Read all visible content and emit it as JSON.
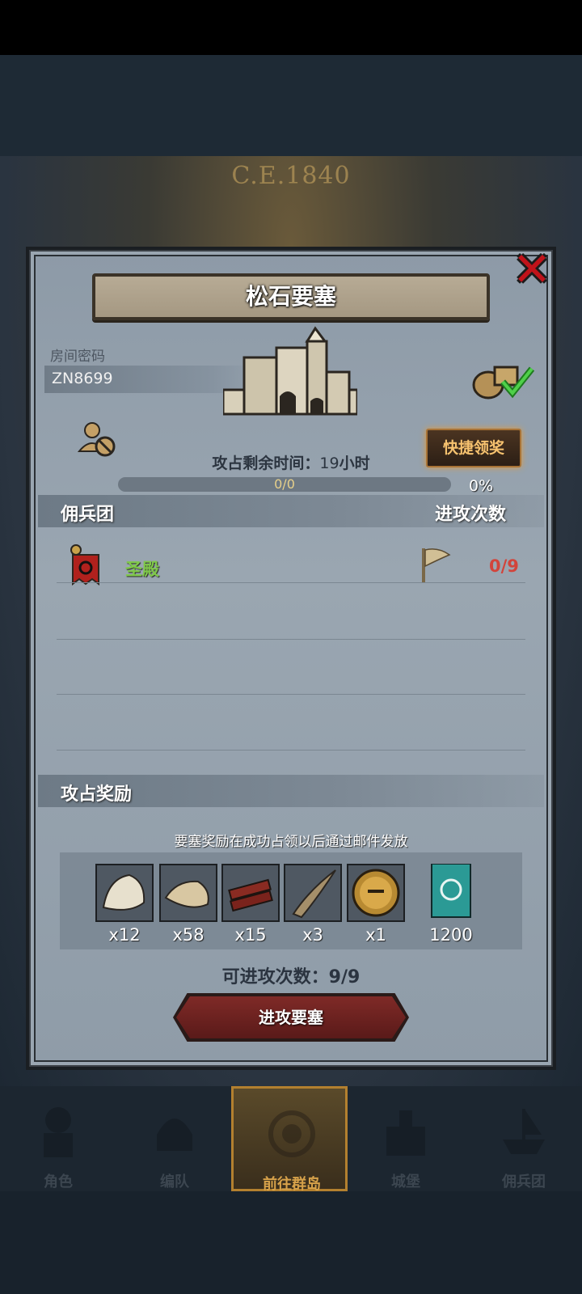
{
  "background": {
    "era_label": "C.E.1840"
  },
  "modal": {
    "title": "松石要塞",
    "room_label": "房间密码",
    "room_code": "ZN8699",
    "quick_claim_label": "快捷领奖",
    "time_label": "攻占剩余时间：",
    "time_value": "19",
    "time_unit": "小时",
    "progress_text": "0/0",
    "progress_fraction": 0,
    "progress_percent": "0%",
    "section_mercenary": "佣兵团",
    "section_attack_count": "进攻次数",
    "mercenary": {
      "name": "圣殿",
      "count": "0/9"
    },
    "section_reward": "攻占奖励",
    "reward_note": "要塞奖励在成功占领以后通过邮件发放",
    "rewards": [
      {
        "icon": "fur-icon",
        "qty": "x12"
      },
      {
        "icon": "leather-icon",
        "qty": "x58"
      },
      {
        "icon": "wood-planks-icon",
        "qty": "x15"
      },
      {
        "icon": "horn-icon",
        "qty": "x3"
      },
      {
        "icon": "knight-helmet-coin-icon",
        "qty": "x1"
      },
      {
        "icon": "guild-banner-icon",
        "qty": "1200"
      }
    ],
    "attempts_label": "可进攻次数：9/9",
    "attack_button": "进攻要塞"
  },
  "nav": {
    "items": [
      {
        "label": "角色",
        "icon": "knight-icon"
      },
      {
        "label": "编队",
        "icon": "helmet-icon"
      },
      {
        "label": "前往群岛",
        "icon": "compass-icon",
        "active": true
      },
      {
        "label": "城堡",
        "icon": "castle-icon"
      },
      {
        "label": "佣兵团",
        "icon": "ship-icon"
      }
    ]
  },
  "colors": {
    "accent_red": "#c0131a",
    "guild_green": "#7fc84a",
    "count_red": "#d2443b",
    "gold": "#d7a24a"
  }
}
